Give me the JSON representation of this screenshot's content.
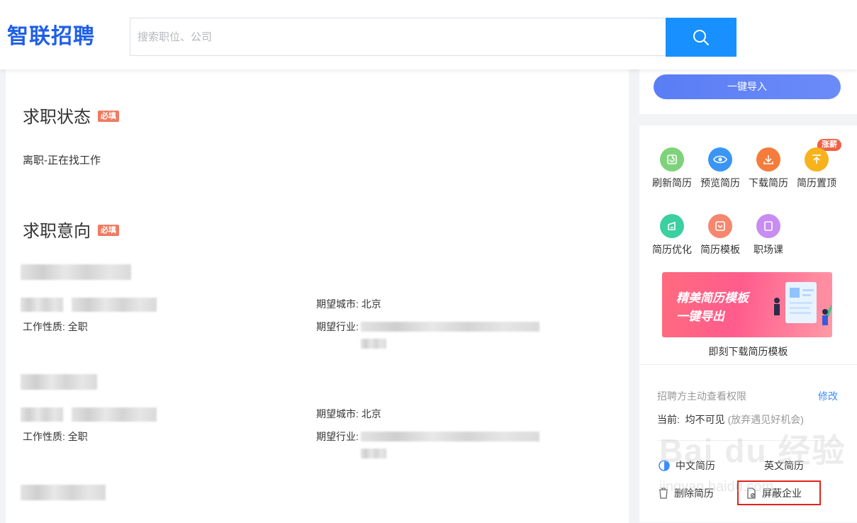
{
  "header": {
    "logo": "智联招聘",
    "search_placeholder": "搜索职位、公司"
  },
  "status_section": {
    "title": "求职状态",
    "required_badge": "必填",
    "value": "离职-正在找工作"
  },
  "intent_section": {
    "title": "求职意向",
    "required_badge": "必填",
    "entries": [
      {
        "city_label": "期望城市:",
        "city": "北京",
        "nature_label": "工作性质:",
        "nature": "全职",
        "industry_label": "期望行业:"
      },
      {
        "city_label": "期望城市:",
        "city": "北京",
        "nature_label": "工作性质:",
        "nature": "全职",
        "industry_label": "期望行业:"
      }
    ]
  },
  "sidebar": {
    "import_button": "一键导入",
    "hot_badge": "涨薪",
    "tools": [
      {
        "label": "刷新简历",
        "icon": "refresh-icon",
        "color": "#7ed37a"
      },
      {
        "label": "预览简历",
        "icon": "eye-icon",
        "color": "#3a95f5"
      },
      {
        "label": "下载简历",
        "icon": "download-icon",
        "color": "#f57c3a"
      },
      {
        "label": "简历置顶",
        "icon": "pin-top-icon",
        "color": "#f7b21c"
      },
      {
        "label": "简历优化",
        "icon": "optimize-icon",
        "color": "#3ccfa0"
      },
      {
        "label": "简历模板",
        "icon": "template-icon",
        "color": "#f5876e"
      },
      {
        "label": "职场课",
        "icon": "course-icon",
        "color": "#c78df3"
      }
    ],
    "banner": {
      "line1": "精美简历模板",
      "line2": "一键导出",
      "caption": "即刻下载简历模板"
    },
    "permission": {
      "label": "招聘方主动查看权限",
      "edit": "修改",
      "current_prefix": "当前:",
      "current_value": "均不可见",
      "current_hint": "(放弃遇见好机会)"
    },
    "actions": {
      "chinese_resume": "中文简历",
      "english_resume": "英文简历",
      "delete_resume": "删除简历",
      "block_company": "屏蔽企业"
    }
  },
  "watermark": {
    "main": "Bai du 经验",
    "sub": "jingyan.baidu.com"
  }
}
